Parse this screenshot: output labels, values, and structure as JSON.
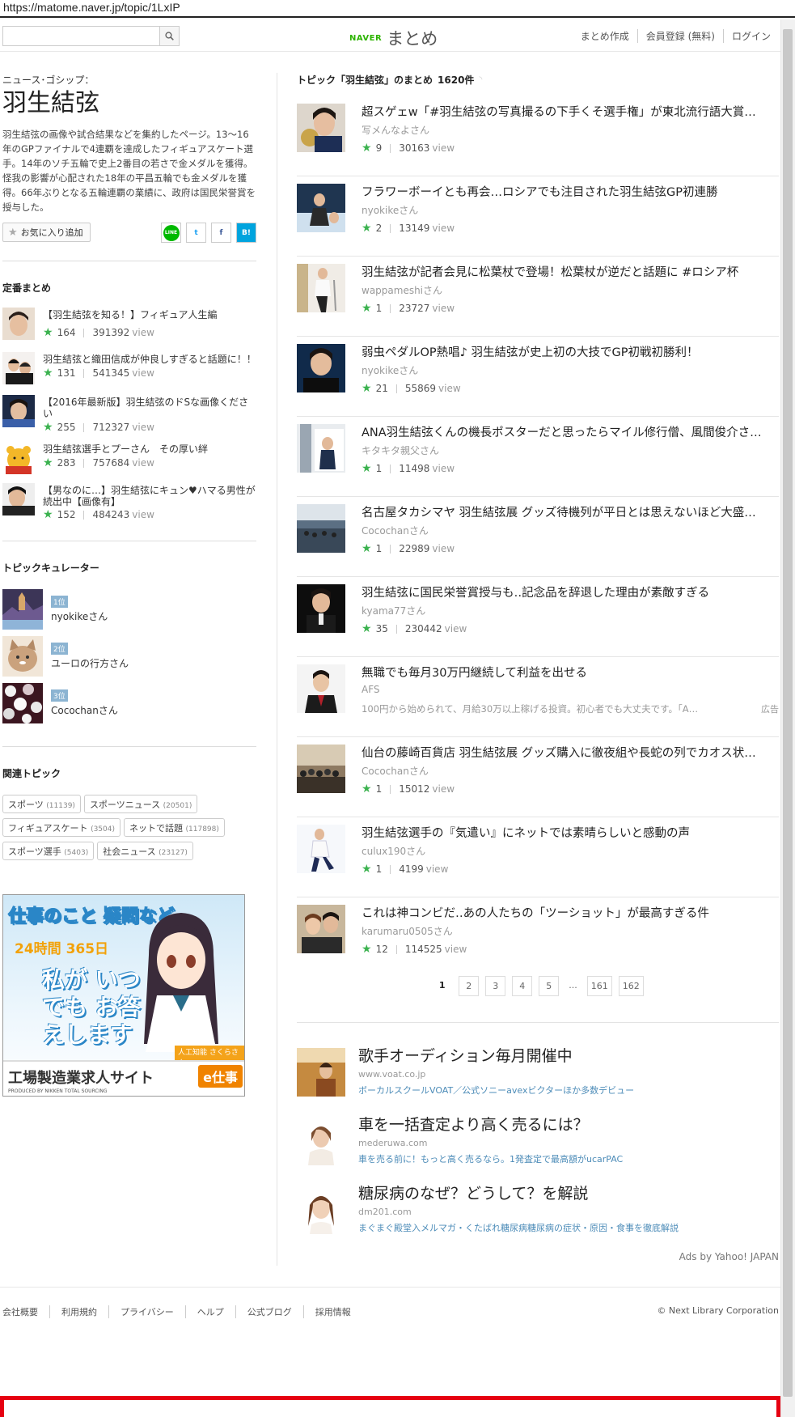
{
  "url": "https://matome.naver.jp/topic/1LxIP",
  "header": {
    "search_placeholder": "",
    "logo_naver": "NAVER",
    "logo_matome": "まとめ",
    "links": [
      "まとめ作成",
      "会員登録 (無料)",
      "ログイン"
    ]
  },
  "topic": {
    "category": "ニュース･ゴシップ：",
    "title": "羽生結弦",
    "description": "羽生結弦の画像や試合結果などを集約したページ。13～16年のGPファイナルで4連覇を達成したフィギュアスケート選手。14年のソチ五輪で史上2番目の若さで金メダルを獲得。怪我の影響が心配された18年の平昌五輪でも金メダルを獲得。66年ぶりとなる五輪連覇の業績に、政府は国民栄誉賞を授与した。",
    "fav_label": "お気に入り追加",
    "share": {
      "line": "LINE",
      "twitter": "t",
      "facebook": "f",
      "hatena": "B!"
    }
  },
  "standard": {
    "title": "定番まとめ",
    "items": [
      {
        "title": "【羽生結弦を知る！】フィギュア人生編",
        "favs": "164",
        "views": "391392",
        "view_label": "view"
      },
      {
        "title": "羽生結弦と織田信成が仲良しすぎると話題に！！",
        "favs": "131",
        "views": "541345",
        "view_label": "view"
      },
      {
        "title": "【2016年最新版】羽生結弦のドSな画像ください",
        "favs": "255",
        "views": "712327",
        "view_label": "view"
      },
      {
        "title": "羽生結弦選手とプーさん　その厚い絆",
        "favs": "283",
        "views": "757684",
        "view_label": "view"
      },
      {
        "title": "【男なのに…】羽生結弦にキュン♥ハマる男性が続出中【画像有】",
        "favs": "152",
        "views": "484243",
        "view_label": "view"
      }
    ]
  },
  "curators": {
    "title": "トピックキュレーター",
    "items": [
      {
        "rank": "1位",
        "name": "nyokikeさん"
      },
      {
        "rank": "2位",
        "name": "ユーロの行方さん"
      },
      {
        "rank": "3位",
        "name": "Cocochanさん"
      }
    ]
  },
  "related": {
    "title": "関連トピック",
    "tags": [
      {
        "name": "スポーツ",
        "count": "(11139)"
      },
      {
        "name": "スポーツニュース",
        "count": "(20501)"
      },
      {
        "name": "フィギュアスケート",
        "count": "(3504)"
      },
      {
        "name": "ネットで話題",
        "count": "(117898)"
      },
      {
        "name": "スポーツ選手",
        "count": "(5403)"
      },
      {
        "name": "社会ニュース",
        "count": "(23127)"
      }
    ]
  },
  "left_ad": {
    "line1": "仕事のこと 疑問など",
    "line2": "24時間 365日",
    "line3": "私が いつでも お答えします",
    "badge": "人工知能 さくらさん",
    "site": "工場製造業求人サイト",
    "brand": "e仕事",
    "produced": "PRODUCED BY NIKKEN TOTAL SOURCING"
  },
  "main": {
    "heading": "トピック「羽生結弦」のまとめ",
    "count": "1620件",
    "articles": [
      {
        "title": "超スゲェw「#羽生結弦の写真撮るの下手くそ選手権」が東北流行語大賞…",
        "author": "写メんなよさん",
        "favs": "9",
        "views": "30163",
        "view_label": "view"
      },
      {
        "title": "フラワーボーイとも再会…ロシアでも注目された羽生結弦GP初連勝",
        "author": "nyokikeさん",
        "favs": "2",
        "views": "13149",
        "view_label": "view"
      },
      {
        "title": "羽生結弦が記者会見に松葉杖で登場！松葉杖が逆だと話題に #ロシア杯",
        "author": "wappameshiさん",
        "favs": "1",
        "views": "23727",
        "view_label": "view"
      },
      {
        "title": "弱虫ペダルOP熱唱♪ 羽生結弦が史上初の大技でGP初戦初勝利！",
        "author": "nyokikeさん",
        "favs": "21",
        "views": "55869",
        "view_label": "view"
      },
      {
        "title": "ANA羽生結弦くんの機長ポスターだと思ったらマイル修行僧、風間俊介さ…",
        "author": "キタキタ親父さん",
        "favs": "1",
        "views": "11498",
        "view_label": "view"
      },
      {
        "title": "名古屋タカシマヤ 羽生結弦展 グッズ待機列が平日とは思えないほど大盛…",
        "author": "Cocochanさん",
        "favs": "1",
        "views": "22989",
        "view_label": "view"
      },
      {
        "title": "羽生結弦に国民栄誉賞授与も‥記念品を辞退した理由が素敵すぎる",
        "author": "kyama77さん",
        "favs": "35",
        "views": "230442",
        "view_label": "view"
      }
    ],
    "ad_article": {
      "title": "無職でも毎月30万円継続して利益を出せる",
      "author": "AFS",
      "desc": "100円から始められて、月給30万以上稼げる投資。初心者でも大丈夫です。「A…",
      "tag": "広告"
    },
    "articles2": [
      {
        "title": "仙台の藤崎百貨店 羽生結弦展 グッズ購入に徹夜組や長蛇の列でカオス状…",
        "author": "Cocochanさん",
        "favs": "1",
        "views": "15012",
        "view_label": "view"
      },
      {
        "title": "羽生結弦選手の『気遣い』にネットでは素晴らしいと感動の声",
        "author": "culux190さん",
        "favs": "1",
        "views": "4199",
        "view_label": "view"
      },
      {
        "title": "これは神コンビだ‥あの人たちの「ツーショット」が最高すぎる件",
        "author": "karumaru0505さん",
        "favs": "12",
        "views": "114525",
        "view_label": "view"
      }
    ],
    "pager": {
      "current": "1",
      "pages": [
        "2",
        "3",
        "4",
        "5"
      ],
      "dots": "...",
      "last": [
        "161",
        "162"
      ]
    }
  },
  "yahoo_ads": {
    "items": [
      {
        "title": "歌手オーディション毎月開催中",
        "url": "www.voat.co.jp",
        "desc": "ボーカルスクールVOAT／公式ソニーavexビクターほか多数デビュー"
      },
      {
        "title": "車を一括査定より高く売るには？",
        "url": "mederuwa.com",
        "desc": "車を売る前に！もっと高く売るなら。1発査定で最高額がucarPAC"
      },
      {
        "title": "糖尿病のなぜ？どうして？を解説",
        "url": "dm201.com",
        "desc": "まぐまぐ殿堂入メルマガ・くたばれ糖尿病糖尿病の症状・原因・食事を徹底解説"
      }
    ],
    "ads_by": "Ads by Yahoo! JAPAN"
  },
  "footer": {
    "links": [
      "会社概要",
      "利用規約",
      "プライバシー",
      "ヘルプ",
      "公式ブログ",
      "採用情報"
    ],
    "copyright": "© Next Library Corporation"
  }
}
